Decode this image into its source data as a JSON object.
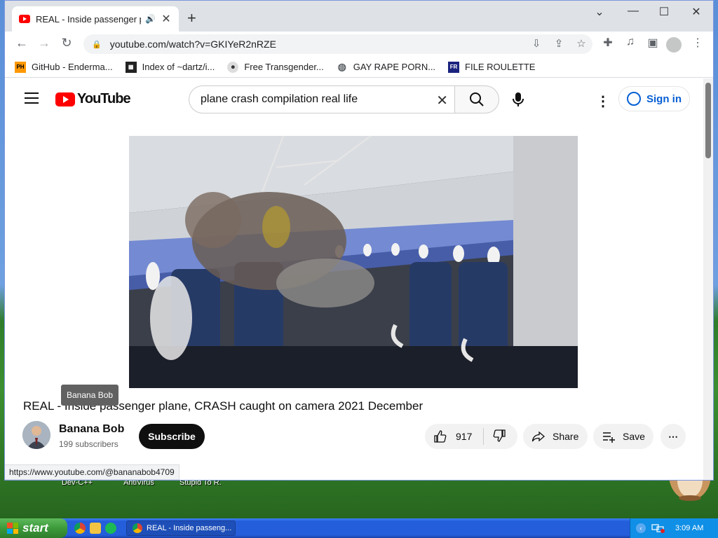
{
  "browser": {
    "tab_title": "REAL - Inside passenger pl",
    "url": "youtube.com/watch?v=GKIYeR2nRZE",
    "bookmarks": [
      {
        "label": "GitHub - Enderma...",
        "icon": "ph-favicon"
      },
      {
        "label": "Index of ~dartz/i...",
        "icon": "qr-favicon"
      },
      {
        "label": "Free Transgender...",
        "icon": "mask-favicon"
      },
      {
        "label": "GAY RAPE PORN...",
        "icon": "globe-favicon"
      },
      {
        "label": "FILE ROULETTE",
        "icon": "file-favicon"
      }
    ],
    "status_url": "https://www.youtube.com/@bananabob4709"
  },
  "youtube": {
    "logo_text": "YouTube",
    "search_value": "plane crash compilation real life",
    "signin_label": "Sign in",
    "video_title": "REAL - Inside passenger plane, CRASH caught on camera 2021 December",
    "channel_name": "Banana Bob",
    "channel_subs": "199 subscribers",
    "channel_tooltip": "Banana Bob",
    "subscribe_label": "Subscribe",
    "like_count": "917",
    "share_label": "Share",
    "save_label": "Save"
  },
  "desktop": {
    "icons": [
      "Dev-C++",
      "AntiVirus",
      "Stupid To R..."
    ]
  },
  "taskbar": {
    "start_label": "start",
    "window_button": "REAL - Inside passeng...",
    "clock": "3:09 AM"
  },
  "colors": {
    "youtube_red": "#ff0000",
    "signin_blue": "#065fd4",
    "xp_taskbar": "#245edb",
    "xp_start": "#3c9a3a"
  }
}
